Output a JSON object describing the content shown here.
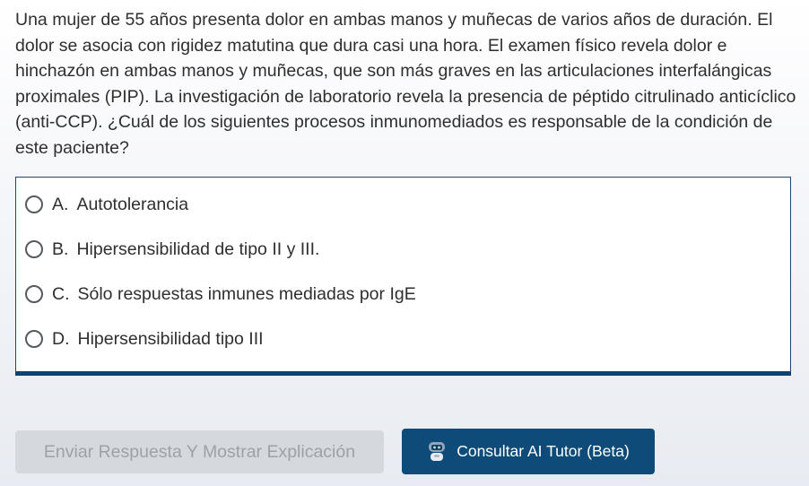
{
  "question": {
    "text": "Una mujer de 55 años presenta dolor en ambas manos y muñecas de varios años de duración. El dolor se asocia con rigidez matutina que dura casi una hora. El examen físico revela dolor e hinchazón en ambas manos y muñecas, que son más graves en las articulaciones interfalángicas proximales (PIP). La investigación de laboratorio revela la presencia de péptido citrulinado anticíclico (anti-CCP). ¿Cuál de los siguientes procesos inmunomediados es responsable de la condición de este paciente?"
  },
  "options": [
    {
      "letter": "A.",
      "text": "Autotolerancia"
    },
    {
      "letter": "B.",
      "text": "Hipersensibilidad de tipo II y III."
    },
    {
      "letter": "C.",
      "text": "Sólo respuestas inmunes mediadas por IgE"
    },
    {
      "letter": "D.",
      "text": "Hipersensibilidad tipo III"
    }
  ],
  "buttons": {
    "submit_label": "Enviar Respuesta Y Mostrar Explicación",
    "tutor_label": "Consultar AI Tutor (Beta)",
    "tutor_icon": "robot-icon"
  },
  "colors": {
    "accent": "#0e4b79",
    "panel_border": "#10426f",
    "disabled_bg": "#d5d8dd",
    "disabled_text": "#9ca2aa"
  }
}
